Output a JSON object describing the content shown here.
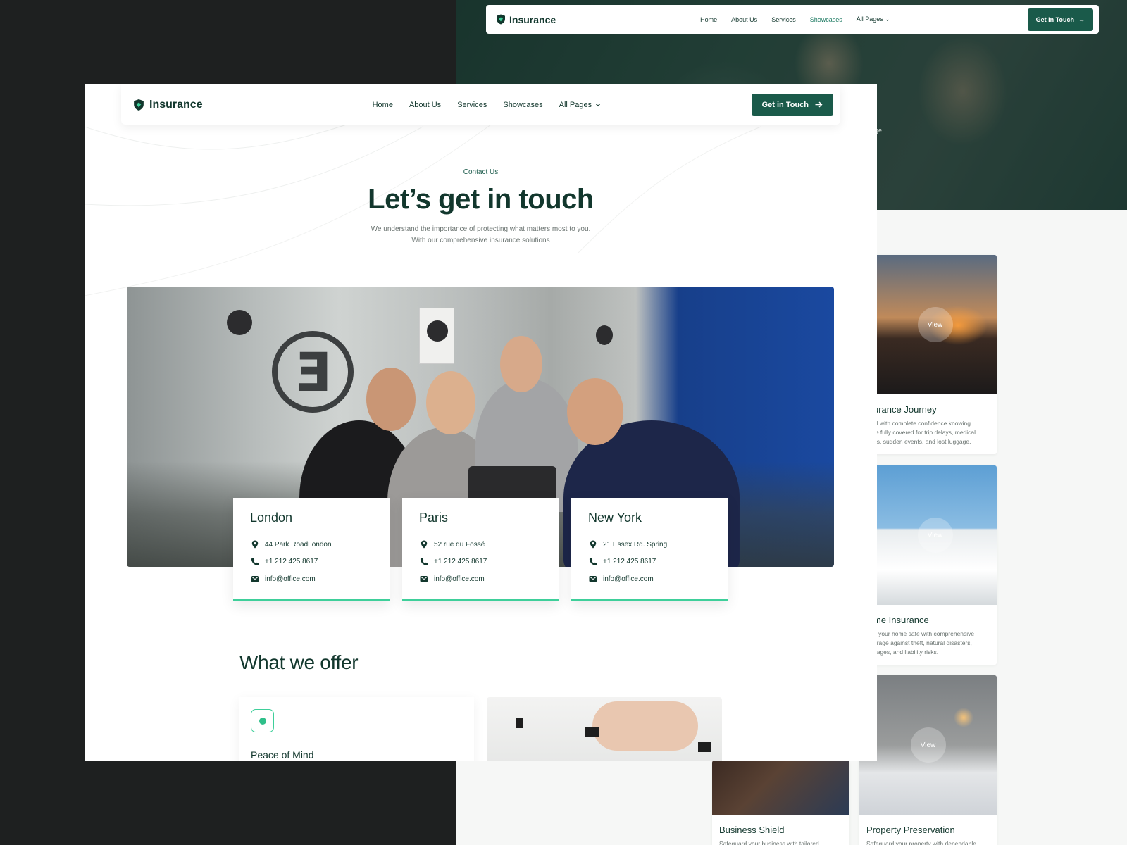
{
  "brand": {
    "name": "Insurance"
  },
  "nav": {
    "items": [
      {
        "label": "Home"
      },
      {
        "label": "About Us"
      },
      {
        "label": "Services"
      },
      {
        "label": "Showcases"
      },
      {
        "label": "All Pages"
      }
    ],
    "cta_label": "Get in Touch"
  },
  "hero": {
    "eyebrow": "Contact Us",
    "title": "Let’s get in touch",
    "subtitle_line1": "We understand the importance of protecting what matters most to you.",
    "subtitle_line2": "With our comprehensive insurance solutions"
  },
  "offices": [
    {
      "city": "London",
      "address": "44 Park RoadLondon",
      "phone": "+1 212 425 8617",
      "email": "info@office.com"
    },
    {
      "city": "Paris",
      "address": "52 rue du Fossé",
      "phone": "+1 212 425 8617",
      "email": "info@office.com"
    },
    {
      "city": "New York",
      "address": "21 Essex Rd. Spring",
      "phone": "+1 212 425 8617",
      "email": "info@office.com"
    }
  ],
  "offer": {
    "title": "What we offer",
    "card_title": "Peace of Mind"
  },
  "back_page": {
    "hero_fragment": "age",
    "cards": [
      {
        "title": "urance Journey",
        "view": "View",
        "desc": [
          "el with complete confidence knowing",
          "re fully covered for trip delays, medical",
          "es, sudden events, and lost luggage."
        ]
      },
      {
        "title": "me Insurance",
        "view": "View",
        "desc": [
          "p your home safe with comprehensive",
          "erage against theft, natural disasters,",
          "nages, and liability risks."
        ]
      },
      {
        "title": "Property Preservation",
        "view": "View",
        "desc": [
          "Safeguard your property with dependable"
        ]
      },
      {
        "title": "Business Shield",
        "desc": [
          "Safeguard your business with tailored"
        ]
      }
    ]
  },
  "colors": {
    "brand_dark": "#12372d",
    "button_green": "#1a5a4a",
    "accent_mint": "#3ecf9a",
    "page_bg": "#1e2020"
  },
  "icons": [
    "shield-logo-icon",
    "chevron-down-icon",
    "arrow-right-icon",
    "location-pin-icon",
    "phone-icon",
    "mail-icon",
    "dot-icon"
  ]
}
